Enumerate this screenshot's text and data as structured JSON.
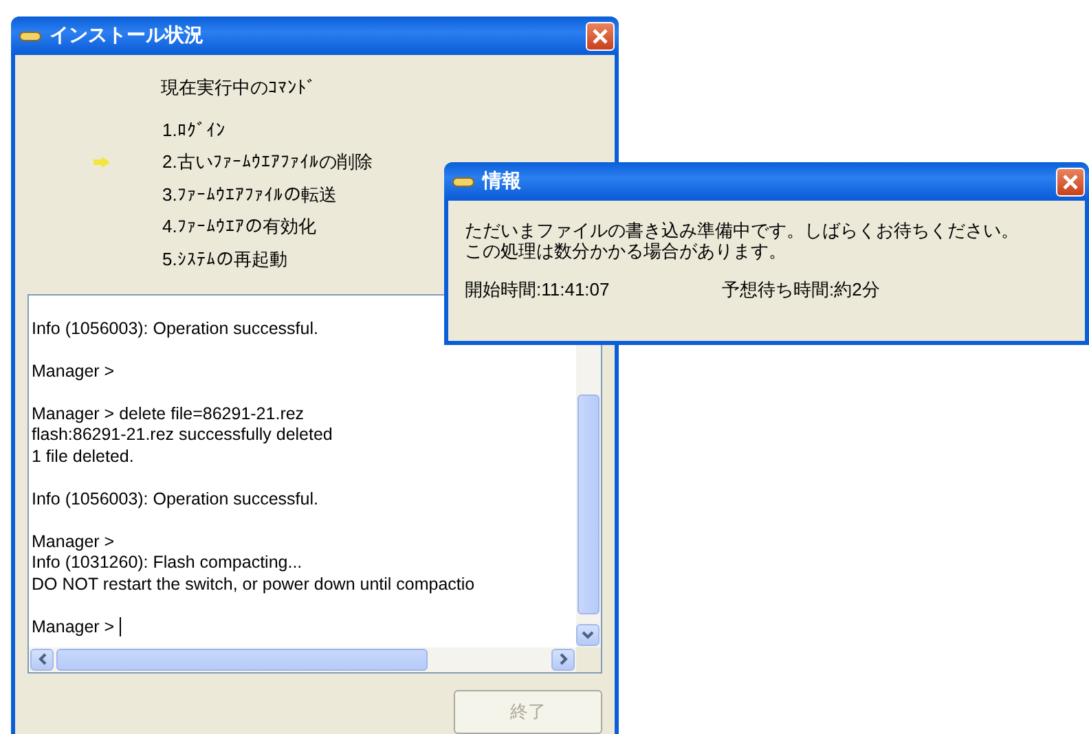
{
  "install_window": {
    "title": "インストール状況",
    "heading": "現在実行中のｺﾏﾝﾄﾞ",
    "steps": [
      {
        "label": "1.ﾛｸﾞｲﾝ",
        "current": false
      },
      {
        "label": "2.古いﾌｧｰﾑｳｴｱﾌｧｲﾙの削除",
        "current": true
      },
      {
        "label": "3.ﾌｧｰﾑｳｴｱﾌｧｲﾙの転送",
        "current": false
      },
      {
        "label": "4.ﾌｧｰﾑｳｴｱの有効化",
        "current": false
      },
      {
        "label": "5.ｼｽﾃﾑの再起動",
        "current": false
      }
    ],
    "log": [
      [
        "Info (1056003): Operation successful."
      ],
      [
        "Manager >"
      ],
      [
        "Manager > delete file=86291-21.rez",
        "flash:86291-21.rez successfully deleted",
        "1 file deleted."
      ],
      [
        "Info (1056003): Operation successful."
      ],
      [
        "Manager >",
        "Info (1031260): Flash compacting...",
        "DO NOT restart the switch, or power down until compactio"
      ],
      [
        "Manager >"
      ]
    ],
    "finish_button": {
      "label": "終了",
      "disabled": true
    }
  },
  "info_dialog": {
    "title": "情報",
    "message": [
      "ただいまファイルの書き込み準備中です。しばらくお待ちください。",
      "この処理は数分かかる場合があります。"
    ],
    "start_time": "開始時間:11:41:07",
    "expected_wait": "予想待ち時間:約2分"
  }
}
